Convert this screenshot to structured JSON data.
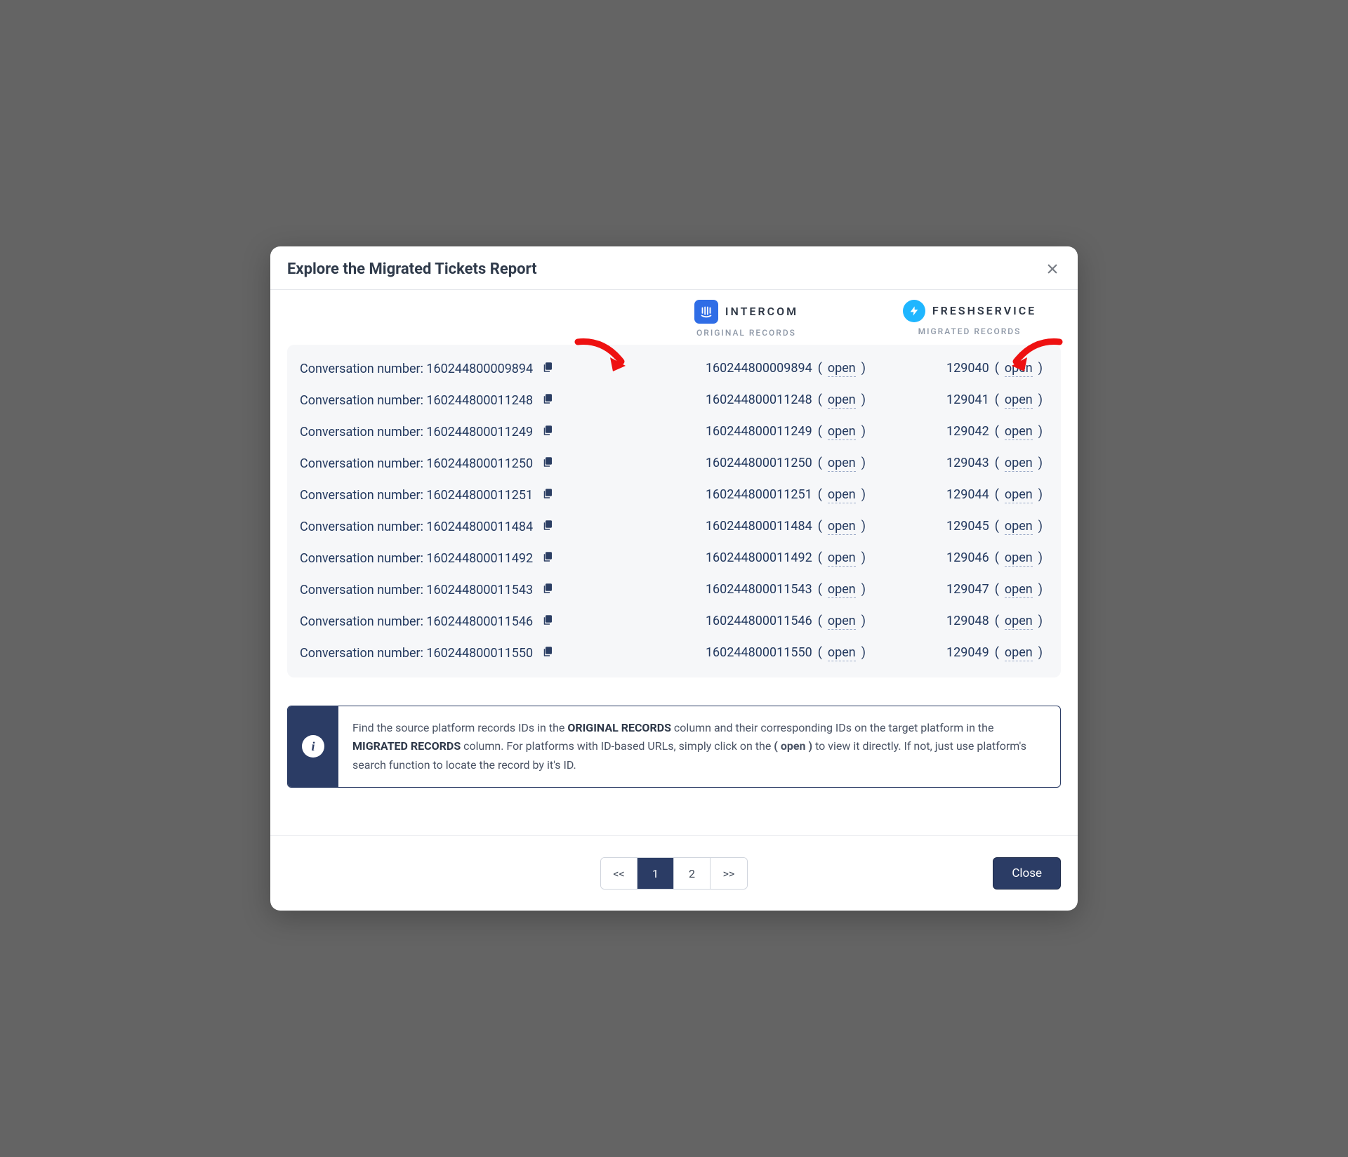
{
  "modal": {
    "title": "Explore the Migrated Tickets Report"
  },
  "columns": {
    "original": {
      "brand": "INTERCOM",
      "subtitle": "ORIGINAL RECORDS"
    },
    "migrated": {
      "brand": "FRESHSERVICE",
      "subtitle": "MIGRATED RECORDS"
    },
    "open_label": "open",
    "label_prefix": "Conversation number: "
  },
  "records": [
    {
      "conv": "160244800009894",
      "orig": "160244800009894",
      "mig": "129040"
    },
    {
      "conv": "160244800011248",
      "orig": "160244800011248",
      "mig": "129041"
    },
    {
      "conv": "160244800011249",
      "orig": "160244800011249",
      "mig": "129042"
    },
    {
      "conv": "160244800011250",
      "orig": "160244800011250",
      "mig": "129043"
    },
    {
      "conv": "160244800011251",
      "orig": "160244800011251",
      "mig": "129044"
    },
    {
      "conv": "160244800011484",
      "orig": "160244800011484",
      "mig": "129045"
    },
    {
      "conv": "160244800011492",
      "orig": "160244800011492",
      "mig": "129046"
    },
    {
      "conv": "160244800011543",
      "orig": "160244800011543",
      "mig": "129047"
    },
    {
      "conv": "160244800011546",
      "orig": "160244800011546",
      "mig": "129048"
    },
    {
      "conv": "160244800011550",
      "orig": "160244800011550",
      "mig": "129049"
    }
  ],
  "info": {
    "t1": "Find the source platform records IDs in the ",
    "b1": "ORIGINAL RECORDS",
    "t2": " column and their corresponding IDs on the target platform in the ",
    "b2": "MIGRATED RECORDS",
    "t3": " column. For platforms with ID-based URLs, simply click on the ",
    "b3": "( open )",
    "t4": " to view it directly. If not, just use platform's search function to locate the record by it's ID."
  },
  "pagination": {
    "prev": "<<",
    "pages": [
      "1",
      "2"
    ],
    "active": "1",
    "next": ">>"
  },
  "footer": {
    "close": "Close"
  }
}
